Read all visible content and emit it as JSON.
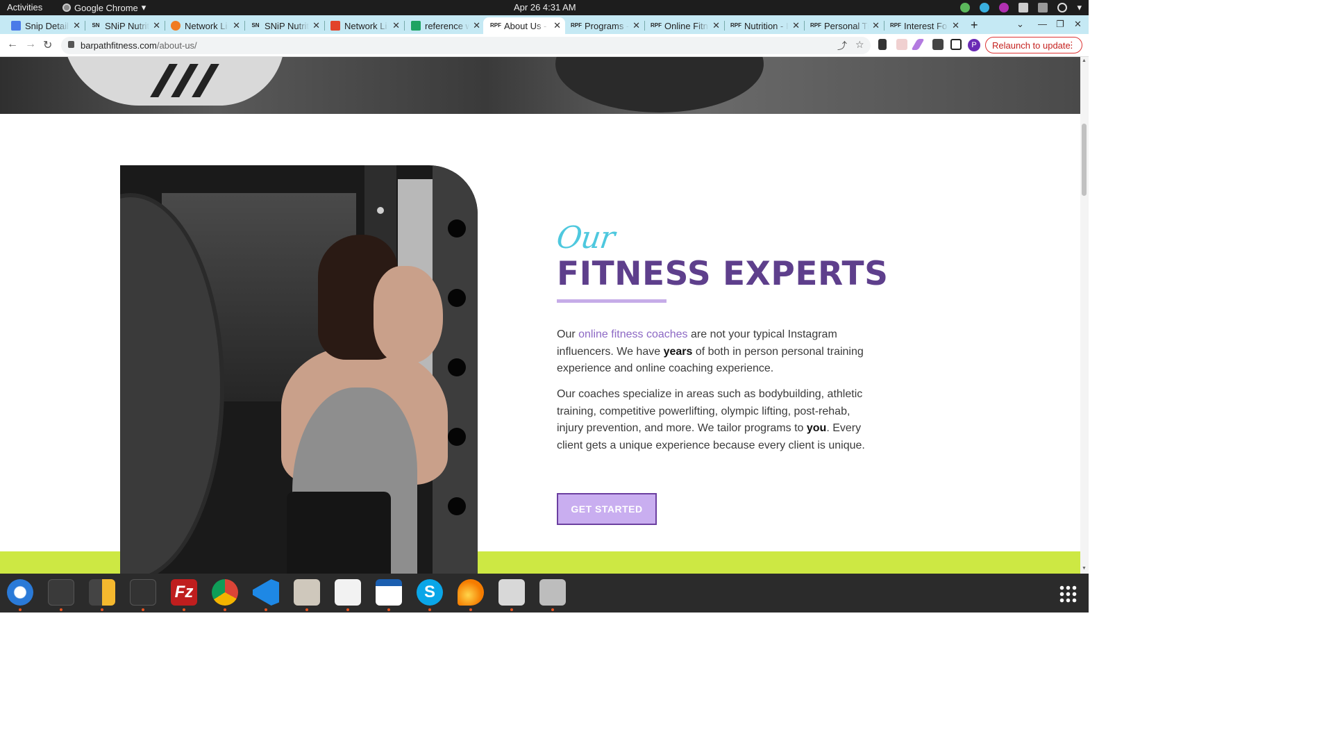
{
  "topbar": {
    "activities": "Activities",
    "app_name": "Google Chrome",
    "clock": "Apr 26  4:31 AM"
  },
  "tabs": [
    {
      "label": "Snip Detail",
      "active": false,
      "icon": "docs-icon"
    },
    {
      "label": "SNiP Nutrition",
      "active": false,
      "icon": "snip-icon"
    },
    {
      "label": "Network Li",
      "active": false,
      "icon": "firefox-icon"
    },
    {
      "label": "SNiP Nutrition",
      "active": false,
      "icon": "snip-icon"
    },
    {
      "label": "Network Li",
      "active": false,
      "icon": "gitlab-icon"
    },
    {
      "label": "reference w",
      "active": false,
      "icon": "sheets-icon"
    },
    {
      "label": "About Us - B",
      "active": true,
      "icon": "rpf-icon"
    },
    {
      "label": "Programs -",
      "active": false,
      "icon": "rpf-icon"
    },
    {
      "label": "Online Fitn",
      "active": false,
      "icon": "rpf-icon"
    },
    {
      "label": "Nutrition - I",
      "active": false,
      "icon": "rpf-icon"
    },
    {
      "label": "Personal Tr",
      "active": false,
      "icon": "rpf-icon"
    },
    {
      "label": "Interest Fo",
      "active": false,
      "icon": "rpf-icon"
    }
  ],
  "address": {
    "domain": "barpathfitness.com",
    "path": "/about-us/"
  },
  "relaunch_label": "Relaunch to update",
  "profile_initial": "P",
  "page": {
    "script_title": "Our",
    "heading": "FITNESS EXPERTS",
    "p1_pre": "Our ",
    "p1_link": "online fitness coaches",
    "p1_mid": " are not your typical Instagram influencers. We have ",
    "p1_bold": "years",
    "p1_post": " of both in person personal training experience and online coaching experience.",
    "p2_pre": "Our coaches specialize in areas such as bodybuilding, athletic training, competitive powerlifting, olympic lifting, post-rehab, injury prevention, and more. We tailor programs to ",
    "p2_bold": "you",
    "p2_post": ". Every client gets a unique experience because every client is unique.",
    "cta": "GET STARTED"
  },
  "colors": {
    "tabstrip": "#c5e9f4",
    "heading": "#5e3f8c",
    "script": "#4ec8de",
    "accent_green": "#cde843",
    "cta_bg": "#c9aef0"
  },
  "dock_apps": [
    "thunderbird-icon",
    "terminal-icon",
    "calculator-icon",
    "system-monitor-icon",
    "filezilla-icon",
    "chrome-icon",
    "vscode-icon",
    "files-icon",
    "text-editor-icon",
    "libreoffice-writer-icon",
    "skype-icon",
    "firefox-nightly-icon",
    "image-viewer-icon",
    "disk-utility-icon"
  ]
}
